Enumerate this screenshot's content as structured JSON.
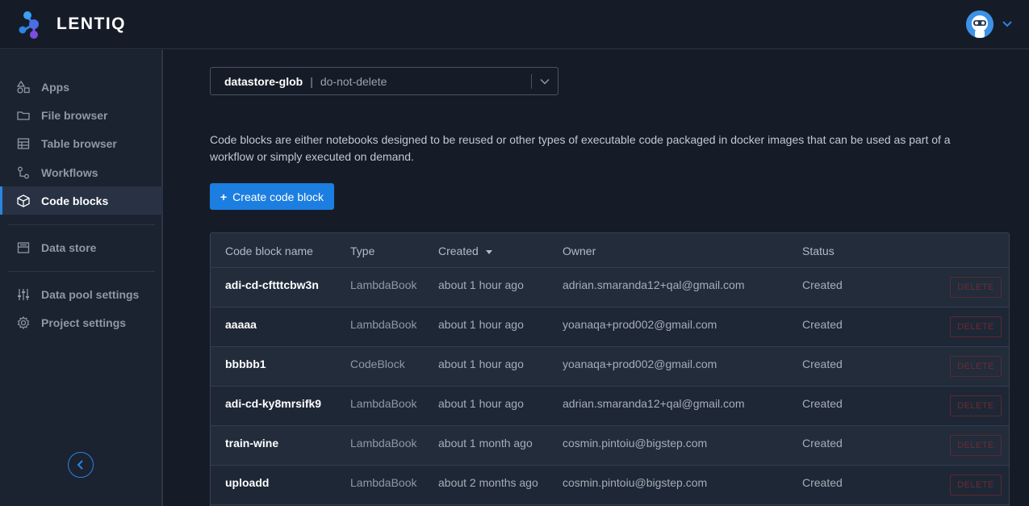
{
  "app": {
    "name": "LENTIQ",
    "colors": {
      "accent": "#1c7ee0",
      "background": "#161c27",
      "sidebar": "#1b2230",
      "danger": "#6b2c33"
    }
  },
  "sidebar": {
    "items": [
      {
        "label": "Apps",
        "icon": "apps-icon"
      },
      {
        "label": "File browser",
        "icon": "folder-icon"
      },
      {
        "label": "Table browser",
        "icon": "table-icon"
      },
      {
        "label": "Workflows",
        "icon": "workflow-icon"
      },
      {
        "label": "Code blocks",
        "icon": "cube-icon",
        "active": true
      },
      {
        "label": "Data store",
        "icon": "datastore-icon"
      },
      {
        "label": "Data pool settings",
        "icon": "sliders-icon"
      },
      {
        "label": "Project settings",
        "icon": "gear-icon"
      }
    ]
  },
  "datastore": {
    "name": "datastore-glob",
    "separator": "|",
    "value": "do-not-delete"
  },
  "main": {
    "description": "Code blocks are either notebooks designed to be reused or other types of executable code packaged in docker images that can be used as part of a workflow or simply executed on demand.",
    "create_button": "Create code block",
    "create_icon": "+"
  },
  "table": {
    "columns": [
      "Code block name",
      "Type",
      "Created",
      "Owner",
      "Status"
    ],
    "delete_label": "DELETE",
    "rows": [
      {
        "name": "adi-cd-cftttcbw3n",
        "type": "LambdaBook",
        "created": "about 1 hour ago",
        "owner": "adrian.smaranda12+qal@gmail.com",
        "status": "Created"
      },
      {
        "name": "aaaaa",
        "type": "LambdaBook",
        "created": "about 1 hour ago",
        "owner": "yoanaqa+prod002@gmail.com",
        "status": "Created"
      },
      {
        "name": "bbbbb1",
        "type": "CodeBlock",
        "created": "about 1 hour ago",
        "owner": "yoanaqa+prod002@gmail.com",
        "status": "Created"
      },
      {
        "name": "adi-cd-ky8mrsifk9",
        "type": "LambdaBook",
        "created": "about 1 hour ago",
        "owner": "adrian.smaranda12+qal@gmail.com",
        "status": "Created"
      },
      {
        "name": "train-wine",
        "type": "LambdaBook",
        "created": "about 1 month ago",
        "owner": "cosmin.pintoiu@bigstep.com",
        "status": "Created"
      },
      {
        "name": "uploadd",
        "type": "LambdaBook",
        "created": "about 2 months ago",
        "owner": "cosmin.pintoiu@bigstep.com",
        "status": "Created"
      }
    ]
  }
}
